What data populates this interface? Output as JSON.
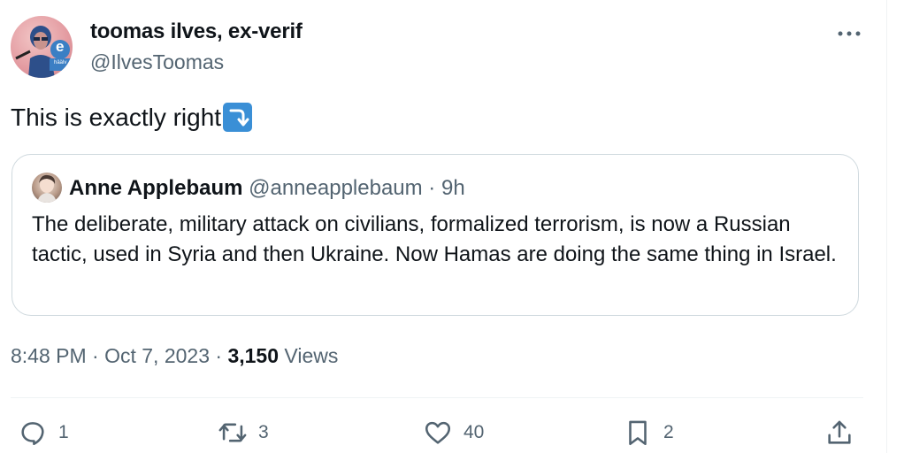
{
  "tweet": {
    "author_name": "toomas ilves, ex-verif",
    "author_handle": "@IlvesToomas",
    "text": "This is exactly right",
    "text_emoji": "right-arrow-curving-down-emoji",
    "timestamp": "8:48 PM · Oct 7, 2023 · ",
    "views_count": "3,150",
    "views_label": " Views"
  },
  "avatar": {
    "letter": "e",
    "small_text": "häälv"
  },
  "quoted": {
    "author_name": "Anne Applebaum",
    "author_handle": "@anneapplebaum",
    "separator": " · ",
    "age": "9h",
    "text": "The deliberate, military attack on civilians, formalized terrorism, is now a Russian tactic, used in Syria and then Ukraine. Now Hamas are doing the same thing in Israel."
  },
  "actions": {
    "reply_count": "1",
    "retweet_count": "3",
    "like_count": "40",
    "bookmark_count": "2"
  },
  "icons": {
    "more": "more-horizontal-icon",
    "reply": "reply-icon",
    "retweet": "retweet-icon",
    "like": "heart-icon",
    "bookmark": "bookmark-icon",
    "share": "share-icon"
  },
  "colors": {
    "text_primary": "#0f1419",
    "text_secondary": "#536471",
    "border": "#cfd9de",
    "emoji_blue": "#3a8fd6"
  }
}
